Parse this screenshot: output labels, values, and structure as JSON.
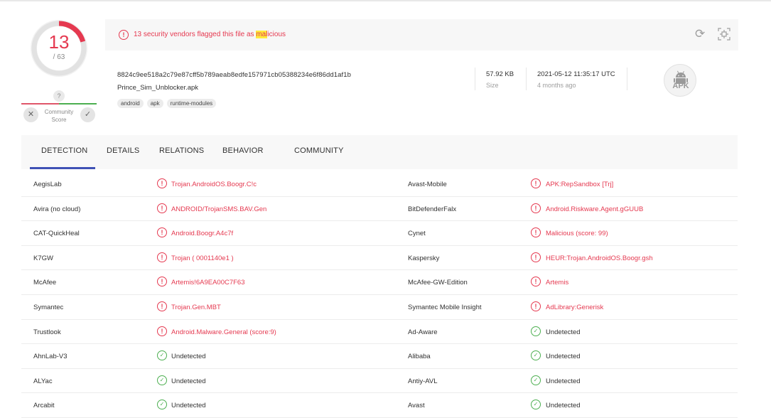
{
  "score": {
    "detected": "13",
    "total": "/ 63",
    "detected_fraction": 0.2063,
    "color": "#e53950"
  },
  "community": {
    "question": "?",
    "label_line1": "Community",
    "label_line2": "Score",
    "icons": [
      "close-icon",
      "check-icon"
    ]
  },
  "summary": {
    "alert_prefix": "13 security vendors flagged this file as ",
    "alert_highlight": "mal",
    "alert_suffix": "icious",
    "hash": "8824c9ee518a2c79e87cff5b789aeab8edfe157971cb05388234e6f86dd1af1b",
    "file_name": "Prince_Sim_Unblocker.apk",
    "tags": [
      "android",
      "apk",
      "runtime-modules"
    ],
    "size": "57.92 KB",
    "size_label": "Size",
    "date": "2021-05-12 11:35:17 UTC",
    "date_relative": "4 months ago",
    "file_type": "APK"
  },
  "tabs": [
    "DETECTION",
    "DETAILS",
    "RELATIONS",
    "BEHAVIOR",
    "COMMUNITY"
  ],
  "detections": [
    {
      "left_vendor": "AegisLab",
      "left_result": "Trojan.AndroidOS.Boogr.C!c",
      "left_status": "malicious",
      "right_vendor": "Avast-Mobile",
      "right_result": "APK:RepSandbox [Trj]",
      "right_status": "malicious"
    },
    {
      "left_vendor": "Avira (no cloud)",
      "left_result": "ANDROID/TrojanSMS.BAV.Gen",
      "left_status": "malicious",
      "right_vendor": "BitDefenderFalx",
      "right_result": "Android.Riskware.Agent.gGUUB",
      "right_status": "malicious"
    },
    {
      "left_vendor": "CAT-QuickHeal",
      "left_result": "Android.Boogr.A4c7f",
      "left_status": "malicious",
      "right_vendor": "Cynet",
      "right_result": "Malicious (score: 99)",
      "right_status": "malicious"
    },
    {
      "left_vendor": "K7GW",
      "left_result": "Trojan ( 0001140e1 )",
      "left_status": "malicious",
      "right_vendor": "Kaspersky",
      "right_result": "HEUR:Trojan.AndroidOS.Boogr.gsh",
      "right_status": "malicious"
    },
    {
      "left_vendor": "McAfee",
      "left_result": "Artemis!6A9EA00C7F63",
      "left_status": "malicious",
      "right_vendor": "McAfee-GW-Edition",
      "right_result": "Artemis",
      "right_status": "malicious"
    },
    {
      "left_vendor": "Symantec",
      "left_result": "Trojan.Gen.MBT",
      "left_status": "malicious",
      "right_vendor": "Symantec Mobile Insight",
      "right_result": "AdLibrary:Generisk",
      "right_status": "malicious"
    },
    {
      "left_vendor": "Trustlook",
      "left_result": "Android.Malware.General (score:9)",
      "left_status": "malicious",
      "right_vendor": "Ad-Aware",
      "right_result": "Undetected",
      "right_status": "undetected"
    },
    {
      "left_vendor": "AhnLab-V3",
      "left_result": "Undetected",
      "left_status": "undetected",
      "right_vendor": "Alibaba",
      "right_result": "Undetected",
      "right_status": "undetected"
    },
    {
      "left_vendor": "ALYac",
      "left_result": "Undetected",
      "left_status": "undetected",
      "right_vendor": "Antiy-AVL",
      "right_result": "Undetected",
      "right_status": "undetected"
    },
    {
      "left_vendor": "Arcabit",
      "left_result": "Undetected",
      "left_status": "undetected",
      "right_vendor": "Avast",
      "right_result": "Undetected",
      "right_status": "undetected"
    }
  ],
  "colors": {
    "malicious": "#e53950",
    "undetected": "#4caf50",
    "accent": "#3f51b5"
  }
}
